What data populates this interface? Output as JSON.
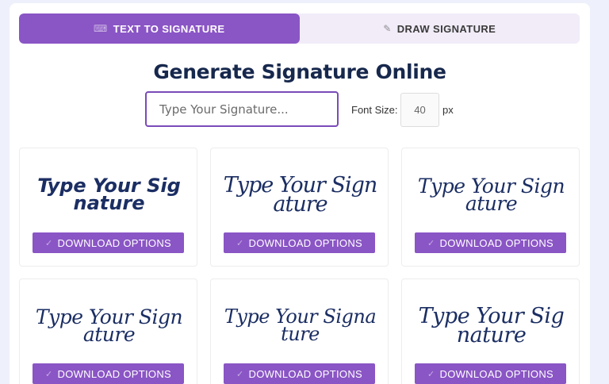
{
  "tabs": {
    "text": {
      "label": "TEXT TO SIGNATURE",
      "icon": "keyboard-icon",
      "glyph": "⌨"
    },
    "draw": {
      "label": "DRAW SIGNATURE",
      "icon": "pen-icon",
      "glyph": "✎"
    }
  },
  "title": "Generate Signature Online",
  "signature_input": {
    "placeholder": "Type Your Signature...",
    "value": ""
  },
  "font_size": {
    "label": "Font Size:",
    "value": "40",
    "unit": "px"
  },
  "cards": [
    {
      "preview": "Type Your Signature",
      "button": "DOWNLOAD OPTIONS",
      "button_icon": "check-icon",
      "glyph": "✓"
    },
    {
      "preview": "Type Your Signature",
      "button": "DOWNLOAD OPTIONS",
      "button_icon": "check-icon",
      "glyph": "✓"
    },
    {
      "preview": "Type Your Signature",
      "button": "DOWNLOAD OPTIONS",
      "button_icon": "check-icon",
      "glyph": "✓"
    },
    {
      "preview": "Type Your Signature",
      "button": "DOWNLOAD OPTIONS",
      "button_icon": "check-icon",
      "glyph": "✓"
    },
    {
      "preview": "Type Your Signature",
      "button": "DOWNLOAD OPTIONS",
      "button_icon": "check-icon",
      "glyph": "✓"
    },
    {
      "preview": "Type Your Signature",
      "button": "DOWNLOAD OPTIONS",
      "button_icon": "check-icon",
      "glyph": "✓"
    }
  ],
  "colors": {
    "accent": "#8a55c5",
    "title": "#17284d",
    "signature_ink": "#1b2e63",
    "background": "#eef0fb"
  }
}
